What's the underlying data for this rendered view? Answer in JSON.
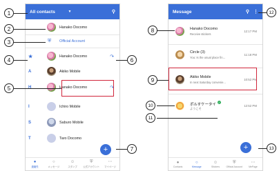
{
  "left": {
    "header": {
      "title": "All contacts",
      "caret_icon": "caret-down-icon",
      "search_icon": "search-icon"
    },
    "my_profile": {
      "name": "Hanako Docomo"
    },
    "official": {
      "label": "Official Account"
    },
    "favorites": [
      {
        "name": "Hanako Docomo"
      }
    ],
    "sections": [
      {
        "letter": "A",
        "name": "Akiko Mobile"
      },
      {
        "letter": "H",
        "name": "Hanako Docomo"
      },
      {
        "letter": "I",
        "name": "Ichiro Mobile"
      },
      {
        "letter": "S",
        "name": "Saburo Mobile"
      },
      {
        "letter": "T",
        "name": "Taro Docomo"
      }
    ],
    "fab": "+",
    "nav": [
      {
        "label": "連絡先",
        "active": true
      },
      {
        "label": "メッセージ",
        "active": false
      },
      {
        "label": "スタンプ",
        "active": false
      },
      {
        "label": "公式アカウント",
        "active": false
      },
      {
        "label": "マイページ",
        "active": false
      }
    ]
  },
  "right": {
    "header": {
      "title": "Message",
      "search_icon": "search-icon",
      "more_icon": "more-vert-icon"
    },
    "threads": [
      {
        "name": "Hanako Docomo",
        "preview": "Receive stickers",
        "time": "12:17 PM"
      },
      {
        "name": "Circle (3)",
        "preview": "You: Is the usual place fin...",
        "time": "11:18 PM"
      },
      {
        "name": "Akiko Mobile",
        "preview": "In next Saturday convenie...",
        "time": "10:52 PM"
      },
      {
        "name": "ポルすケータイ",
        "preview": "ようこそ",
        "time": "12:52 PM"
      }
    ],
    "fab": "+",
    "nav": [
      {
        "label": "Contacts",
        "active": false
      },
      {
        "label": "Message",
        "active": true
      },
      {
        "label": "Stickers",
        "active": false
      },
      {
        "label": "Official Account",
        "active": false
      },
      {
        "label": "MePage",
        "active": false
      }
    ]
  },
  "callouts": [
    "1",
    "2",
    "3",
    "4",
    "5",
    "6",
    "7",
    "8",
    "9",
    "10",
    "11",
    "12",
    "13"
  ],
  "colors": {
    "accent": "#3a6fd8",
    "highlight": "#d0243a"
  }
}
